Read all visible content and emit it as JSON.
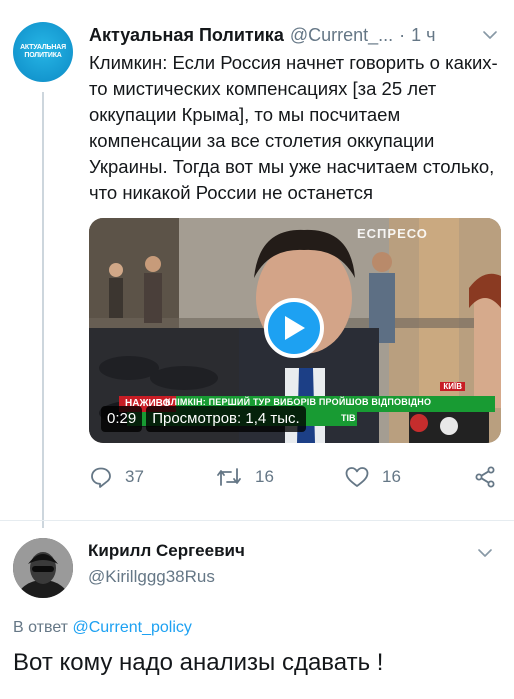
{
  "tweet": {
    "author": {
      "name": "Актуальная Политика",
      "handle": "@Current_...",
      "avatar_text": [
        "АКТУАЛЬНАЯ",
        "ПОЛИТИКА"
      ]
    },
    "time": "1 ч",
    "text": "Климкин: Если Россия начнет говорить о каких-то мистических компенсациях [за 25 лет оккупации Крыма], то мы посчитаем компенсации за все столетия оккупации Украины. Тогда вот мы уже насчитаем столько, что никакой России не останется",
    "video": {
      "duration": "0:29",
      "views": "Просмотров: 1,4 тыс.",
      "brand": "ЕСПРЕСО",
      "live_tag": "НАЖИВО",
      "city": "КИЇВ",
      "ticker": "КЛІМКІН: ПЕРШИЙ ТУР ВИБОРІВ ПРОЙШОВ ВІДПОВІДНО",
      "ticker2": "ТІВ"
    },
    "actions": {
      "replies": "37",
      "retweets": "16",
      "likes": "16"
    }
  },
  "reply": {
    "author": {
      "name": "Кирилл Сергеевич",
      "handle": "@Kirillggg38Rus"
    },
    "reply_prefix": "В ответ",
    "reply_mention": "@Current_policy",
    "text": "Вот кому надо анализы сдавать !"
  },
  "colors": {
    "accent": "#1da1f2",
    "muted": "#657786",
    "text": "#14171a",
    "ticker_green": "#189b33"
  }
}
